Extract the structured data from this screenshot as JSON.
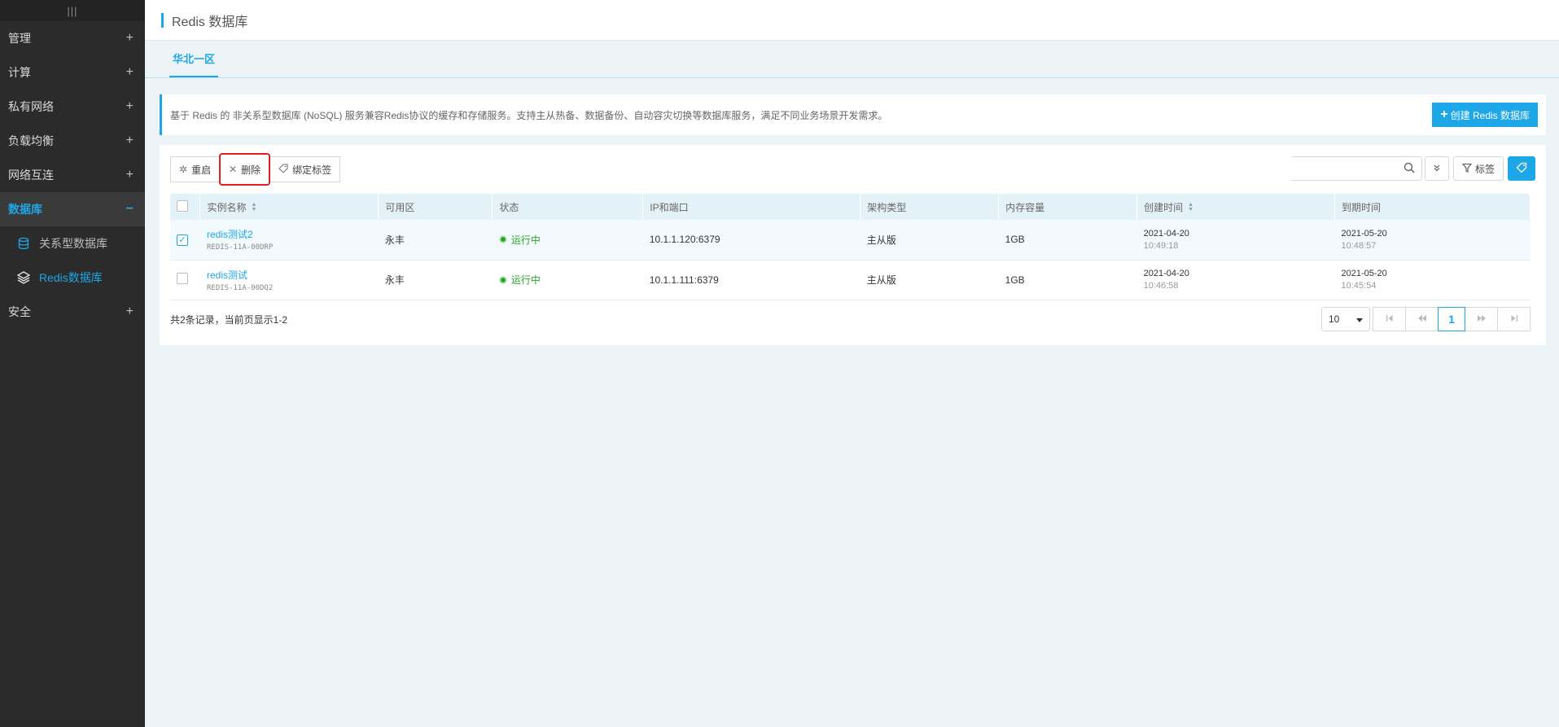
{
  "sidebar": {
    "toggle": "|||",
    "items": [
      {
        "label": "管理",
        "expander": "+"
      },
      {
        "label": "计算",
        "expander": "+"
      },
      {
        "label": "私有网络",
        "expander": "+"
      },
      {
        "label": "负载均衡",
        "expander": "+"
      },
      {
        "label": "网络互连",
        "expander": "+"
      },
      {
        "label": "数据库",
        "expander": "−"
      },
      {
        "label": "安全",
        "expander": "+"
      }
    ],
    "subitems": [
      {
        "label": "关系型数据库",
        "icon": "database-icon"
      },
      {
        "label": "Redis数据库",
        "icon": "layers-icon"
      }
    ]
  },
  "header": {
    "title": "Redis 数据库"
  },
  "tabs": [
    {
      "label": "华北一区"
    }
  ],
  "info": {
    "text": "基于 Redis 的 非关系型数据库 (NoSQL) 服务兼容Redis协议的缓存和存储服务。支持主从热备、数据备份、自动容灾切换等数据库服务，满足不同业务场景开发需求。",
    "create_label": "创建 Redis 数据库"
  },
  "toolbar": {
    "restart_label": "重启",
    "delete_label": "删除",
    "bind_tag_label": "绑定标签",
    "search_value": "",
    "filter_label": "标签"
  },
  "table": {
    "headers": [
      "实例名称",
      "可用区",
      "状态",
      "IP和端口",
      "架构类型",
      "内存容量",
      "创建时间",
      "到期时间"
    ],
    "rows": [
      {
        "checked": true,
        "name": "redis测试2",
        "id": "REDIS-11A-00DRP",
        "zone": "永丰",
        "status": "运行中",
        "ip": "10.1.1.120:6379",
        "arch": "主从版",
        "memory": "1GB",
        "created_date": "2021-04-20",
        "created_time": "10:49:18",
        "expire_date": "2021-05-20",
        "expire_time": "10:48:57"
      },
      {
        "checked": false,
        "name": "redis测试",
        "id": "REDIS-11A-00DQ2",
        "zone": "永丰",
        "status": "运行中",
        "ip": "10.1.1.111:6379",
        "arch": "主从版",
        "memory": "1GB",
        "created_date": "2021-04-20",
        "created_time": "10:46:58",
        "expire_date": "2021-05-20",
        "expire_time": "10:45:54"
      }
    ]
  },
  "footer": {
    "records": "共2条记录，当前页显示1-2",
    "page_size": "10",
    "current_page": "1"
  },
  "colors": {
    "accent": "#1ea7e6",
    "sidebar_bg": "#2b2b2b",
    "running": "#2aa52a",
    "highlight": "#e02020"
  }
}
